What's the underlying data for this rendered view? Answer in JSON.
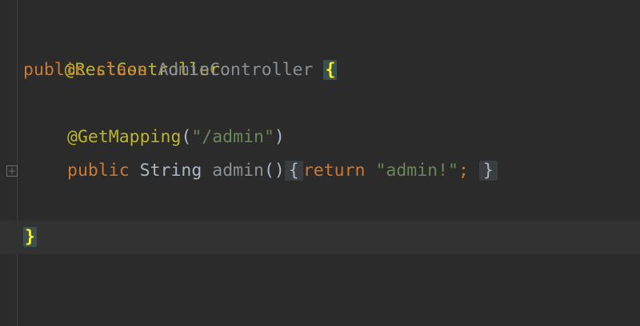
{
  "editor": {
    "line1": {
      "annotation": "@RestController"
    },
    "line2": {
      "kw_public": "public",
      "kw_class": "class",
      "class_name": "AdminController",
      "brace_open": "{"
    },
    "line4": {
      "annotation": "@GetMapping",
      "paren_open": "(",
      "path": "\"/admin\"",
      "paren_close": ")"
    },
    "line5": {
      "kw_public": "public",
      "type": "String",
      "method": "admin",
      "parens": "()",
      "fold_open": "{",
      "kw_return": "return",
      "value": "\"admin!\"",
      "semicolon": ";",
      "fold_close": "}"
    },
    "line7": {
      "brace_close": "}"
    }
  }
}
